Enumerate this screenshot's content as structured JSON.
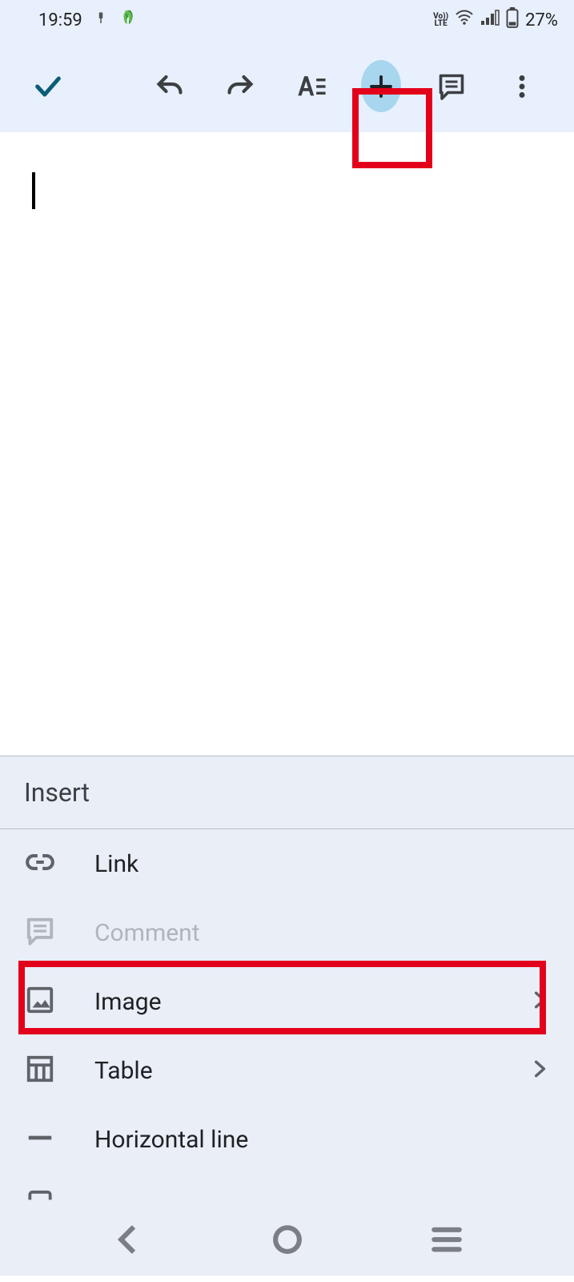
{
  "status": {
    "time": "19:59",
    "battery_pct": "27%",
    "volte": "Vo))\nLTE"
  },
  "toolbar": {
    "done": "done",
    "undo": "undo",
    "redo": "redo",
    "format": "format",
    "insert": "insert",
    "comments": "comments",
    "overflow": "overflow"
  },
  "insert": {
    "title": "Insert",
    "items": [
      {
        "label": "Link",
        "disabled": false,
        "chevron": false
      },
      {
        "label": "Comment",
        "disabled": true,
        "chevron": false
      },
      {
        "label": "Image",
        "disabled": false,
        "chevron": true
      },
      {
        "label": "Table",
        "disabled": false,
        "chevron": true
      },
      {
        "label": "Horizontal line",
        "disabled": false,
        "chevron": false
      }
    ]
  }
}
